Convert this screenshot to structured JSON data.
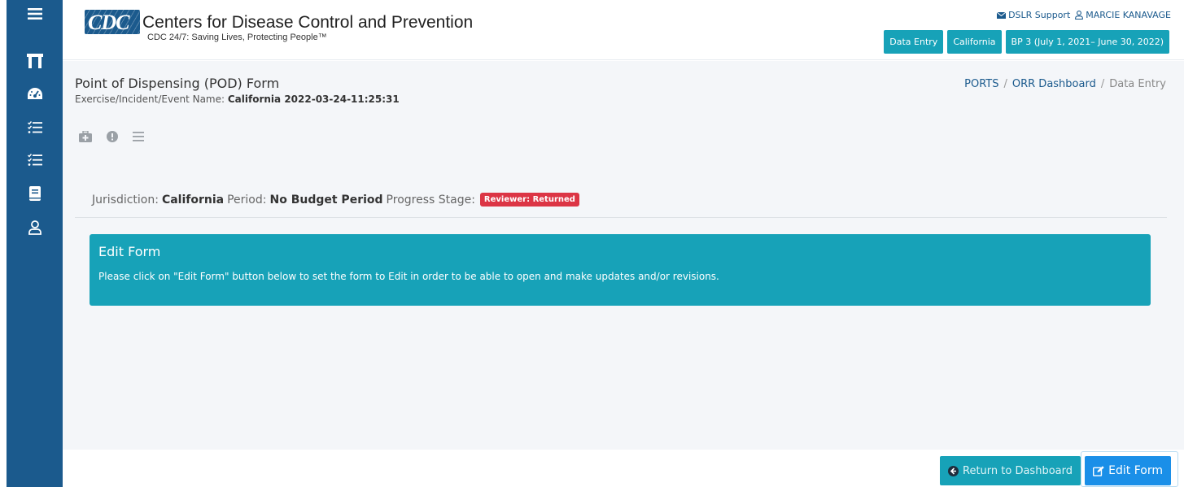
{
  "sidebar": {
    "icons": [
      "menu-icon",
      "columns-icon",
      "dashboard-gauge-icon",
      "checklist-icon",
      "checklist-icon",
      "book-icon",
      "user-icon"
    ]
  },
  "header": {
    "logo_text": "CDC",
    "org_name": "Centers for Disease Control and Prevention",
    "org_tagline": "CDC 24/7: Saving Lives, Protecting People™",
    "support_label": "DSLR Support",
    "user_name": "MARCIE KANAVAGE",
    "pills": {
      "mode": "Data Entry",
      "jurisdiction": "California",
      "period": "BP 3 (July 1, 2021– June 30, 2022)"
    }
  },
  "page": {
    "title": "Point of Dispensing (POD) Form",
    "subtitle_label": "Exercise/Incident/Event Name:",
    "subtitle_value": "California 2022-03-24-11:25:31",
    "breadcrumb": {
      "item1": "PORTS",
      "item2": "ORR Dashboard",
      "current": "Data Entry",
      "separator": "/"
    },
    "meta": {
      "jurisdiction_label": "Jurisdiction:",
      "jurisdiction_value": "California",
      "period_label": "Period:",
      "period_value": "No Budget Period",
      "stage_label": "Progress Stage:",
      "stage_value": "Reviewer: Returned"
    },
    "alert": {
      "title": "Edit Form",
      "text": "Please click on \"Edit Form\" button below to set the form to Edit in order to be able to open and make updates and/or revisions."
    }
  },
  "footer": {
    "return_label": "Return to Dashboard",
    "edit_label": "Edit Form"
  },
  "colors": {
    "sidebar": "#1b5a8d",
    "teal": "#17a2b8",
    "primary": "#1a8fe8",
    "danger": "#dc3545"
  }
}
